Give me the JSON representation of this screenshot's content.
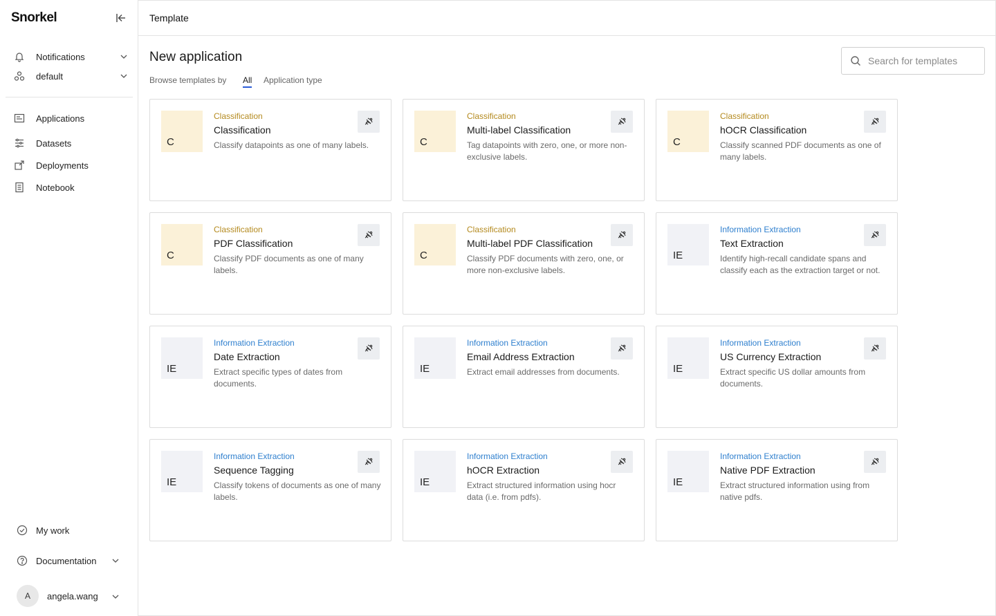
{
  "app": {
    "logo": "Snorkel"
  },
  "sidebar": {
    "top_items": [
      {
        "label": "Notifications",
        "icon": "bell-icon"
      },
      {
        "label": "default",
        "icon": "workspace-icon"
      }
    ],
    "nav_items": [
      {
        "label": "Applications",
        "icon": "applications-icon"
      },
      {
        "label": "Datasets",
        "icon": "datasets-icon"
      },
      {
        "label": "Deployments",
        "icon": "deployments-icon"
      },
      {
        "label": "Notebook",
        "icon": "notebook-icon"
      }
    ],
    "bottom_items": [
      {
        "label": "My work",
        "icon": "check-circle-icon"
      },
      {
        "label": "Documentation",
        "icon": "help-circle-icon"
      }
    ],
    "user": {
      "initial": "A",
      "name": "angela.wang"
    }
  },
  "header": {
    "title": "Template"
  },
  "main": {
    "title": "New application",
    "browse_label": "Browse templates by",
    "tabs": [
      {
        "label": "All",
        "selected": true
      },
      {
        "label": "Application type",
        "selected": false
      }
    ],
    "search": {
      "placeholder": "Search for templates",
      "value": ""
    }
  },
  "colors": {
    "classification_badge": "#fbf1d8",
    "classification_text": "#b48a1e",
    "extraction_badge": "#f1f2f6",
    "extraction_text": "#2e7fce",
    "tab_underline": "#2a5bd7"
  },
  "templates": [
    {
      "badge": "C",
      "category": "Classification",
      "name": "Classification",
      "description": "Classify datapoints as one of many labels."
    },
    {
      "badge": "C",
      "category": "Classification",
      "name": "Multi-label Classification",
      "description": "Tag datapoints with zero, one, or more non-exclusive labels."
    },
    {
      "badge": "C",
      "category": "Classification",
      "name": "hOCR Classification",
      "description": "Classify scanned PDF documents as one of many labels."
    },
    {
      "badge": "C",
      "category": "Classification",
      "name": "PDF Classification",
      "description": "Classify PDF documents as one of many labels."
    },
    {
      "badge": "C",
      "category": "Classification",
      "name": "Multi-label PDF Classification",
      "description": "Classify PDF documents with zero, one, or more non-exclusive labels."
    },
    {
      "badge": "IE",
      "category": "Information Extraction",
      "name": "Text Extraction",
      "description": "Identify high-recall candidate spans and classify each as the extraction target or not."
    },
    {
      "badge": "IE",
      "category": "Information Extraction",
      "name": "Date Extraction",
      "description": "Extract specific types of dates from documents."
    },
    {
      "badge": "IE",
      "category": "Information Extraction",
      "name": "Email Address Extraction",
      "description": "Extract email addresses from documents."
    },
    {
      "badge": "IE",
      "category": "Information Extraction",
      "name": "US Currency Extraction",
      "description": "Extract specific US dollar amounts from documents."
    },
    {
      "badge": "IE",
      "category": "Information Extraction",
      "name": "Sequence Tagging",
      "description": "Classify tokens of documents as one of many labels."
    },
    {
      "badge": "IE",
      "category": "Information Extraction",
      "name": "hOCR Extraction",
      "description": "Extract structured information using hocr data (i.e. from pdfs)."
    },
    {
      "badge": "IE",
      "category": "Information Extraction",
      "name": "Native PDF Extraction",
      "description": "Extract structured information using from native pdfs."
    }
  ]
}
